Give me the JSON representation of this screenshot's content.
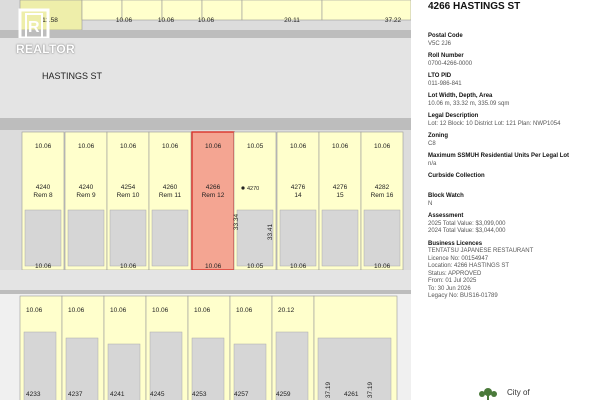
{
  "map": {
    "street_name": "HASTINGS ST",
    "top_labels": [
      "11.58",
      "10.06",
      "10.06",
      "10.06",
      "20.11",
      "37.22"
    ],
    "lots": [
      {
        "id": "lot-4240-rem8",
        "number": "4240",
        "name": "Rem 8",
        "dim_top": "10.06",
        "dim_bottom": "10.06"
      },
      {
        "id": "lot-4240-rem9",
        "number": "4240",
        "name": "Rem 9",
        "dim_top": "10.06",
        "dim_bottom": ""
      },
      {
        "id": "lot-4254-rem10",
        "number": "4254",
        "name": "Rem 10",
        "dim_top": "10.06",
        "dim_bottom": "10.06"
      },
      {
        "id": "lot-4260-rem11",
        "number": "4260",
        "name": "Rem 11",
        "dim_top": "10.06",
        "dim_bottom": ""
      },
      {
        "id": "lot-4266-rem12",
        "number": "4266",
        "name": "Rem 12",
        "dim_top": "10.06",
        "dim_bottom": "10.06",
        "highlight": true
      },
      {
        "id": "lot-4270",
        "number": "4270",
        "name": "",
        "dim_top": "10.05",
        "dim_bottom": "10.05"
      },
      {
        "id": "lot-4276-14",
        "number": "4276",
        "name": "14",
        "dim_top": "10.06",
        "dim_bottom": "10.06"
      },
      {
        "id": "lot-4276-15",
        "number": "4276",
        "name": "15",
        "dim_top": "10.06",
        "dim_bottom": ""
      },
      {
        "id": "lot-4282-rem16",
        "number": "4282",
        "name": "Rem 16",
        "dim_top": "10.06",
        "dim_bottom": "10.06"
      }
    ],
    "side_dims": [
      "33.34",
      "33.41"
    ],
    "lower_dims": [
      "10.06",
      "10.06",
      "10.06",
      "10.06",
      "10.06",
      "10.06",
      "20.12"
    ],
    "lower_lots": [
      "4233",
      "4237",
      "4241",
      "4245",
      "4253",
      "4257",
      "4259",
      "4261"
    ],
    "lower_side_dims": [
      "37.19",
      "37.19"
    ],
    "highlight_color": "#f4a592",
    "highlight_border": "#d9342b",
    "watermark_text": "REALTOR",
    "watermark_icon": "realtor-house-icon"
  },
  "panel": {
    "title": "4266 HASTINGS ST",
    "fields": [
      {
        "key": "postal",
        "label": "Postal Code",
        "value": [
          "V5C 2J6"
        ]
      },
      {
        "key": "roll",
        "label": "Roll Number",
        "value": [
          "0700-4266-0000"
        ]
      },
      {
        "key": "ltopid",
        "label": "LTO PID",
        "value": [
          "011-986-841"
        ]
      },
      {
        "key": "lotsize",
        "label": "Lot Width, Depth, Area",
        "value": [
          "10.06 m, 33.32 m, 335.09 sqm"
        ]
      },
      {
        "key": "legal",
        "label": "Legal Description",
        "value": [
          "Lot: 12 Block: 10 District Lot: 121 Plan: NWP1054"
        ]
      },
      {
        "key": "zoning",
        "label": "Zoning",
        "value": [
          "C8"
        ]
      },
      {
        "key": "ssmuh",
        "label": "Maximum SSMUH Residential Units Per Legal Lot",
        "value": [
          "n/a"
        ]
      },
      {
        "key": "curbside",
        "label": "Curbside Collection",
        "value": [
          ""
        ]
      },
      {
        "key": "blockwatch",
        "label": "Block Watch",
        "value": [
          "N"
        ]
      },
      {
        "key": "assessment",
        "label": "Assessment",
        "value": [
          "2025 Total Value: $3,099,000",
          "2024 Total Value: $3,044,000"
        ]
      },
      {
        "key": "licences",
        "label": "Business Licences",
        "value": [
          "TENTATSU JAPANESE RESTAURANT",
          "Licence No: 00154947",
          "Location: 4266 HASTINGS ST",
          "Status: APPROVED",
          "From: 01 Jul 2025",
          "To: 30 Jun 2026",
          "Legacy No: BUS16-01789"
        ]
      }
    ],
    "city_text": "City of",
    "city_icon": "city-logo-icon"
  }
}
